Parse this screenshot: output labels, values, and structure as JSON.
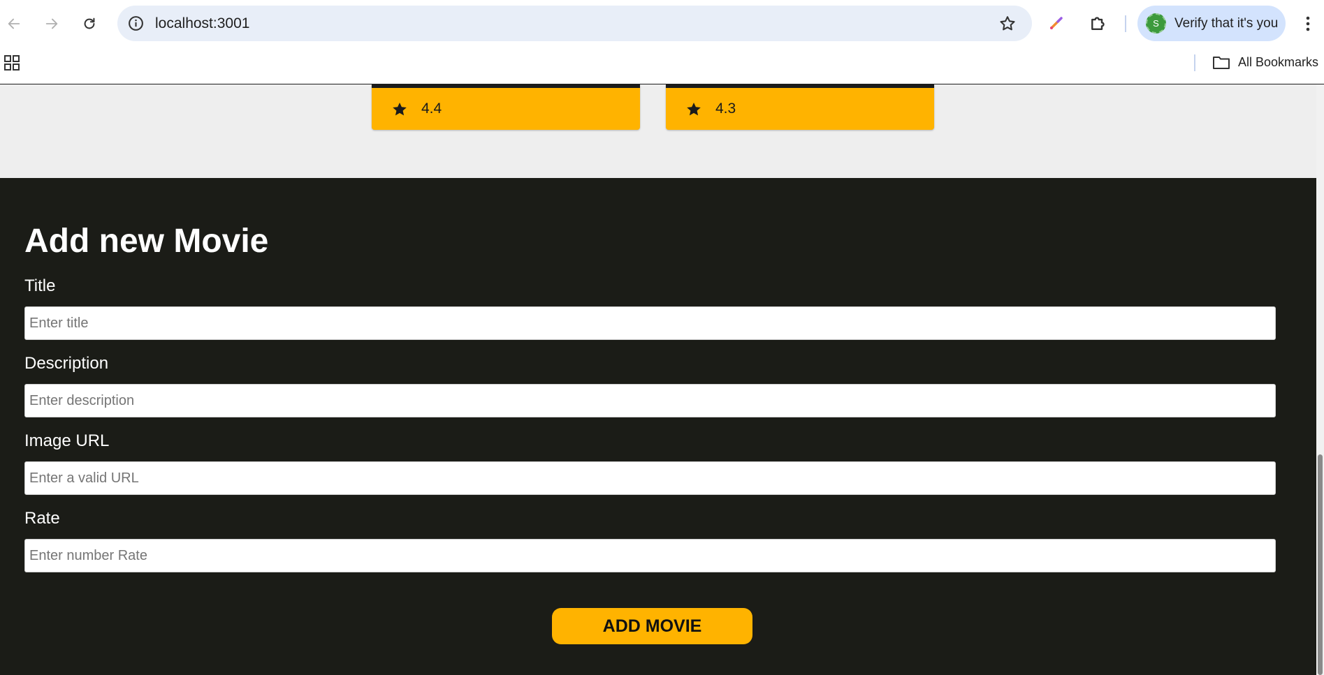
{
  "browser": {
    "url": "localhost:3001",
    "profile_chip_label": "Verify that it's you",
    "profile_avatar_letter": "S",
    "bookmarks_label": "All Bookmarks"
  },
  "movie_cards": [
    {
      "rating": "4.4"
    },
    {
      "rating": "4.3"
    }
  ],
  "form": {
    "title": "Add new Movie",
    "fields": {
      "title": {
        "label": "Title",
        "placeholder": "Enter title",
        "value": ""
      },
      "description": {
        "label": "Description",
        "placeholder": "Enter description",
        "value": ""
      },
      "image_url": {
        "label": "Image URL",
        "placeholder": "Enter a valid URL",
        "value": ""
      },
      "rate": {
        "label": "Rate",
        "placeholder": "Enter number Rate",
        "value": ""
      }
    },
    "submit_label": "ADD MOVIE"
  },
  "colors": {
    "accent": "#ffb300",
    "form_background": "#1b1c17",
    "page_background": "#eeeeee",
    "omnibox": "#e8eef8",
    "profile_chip": "#d3e3fd"
  }
}
